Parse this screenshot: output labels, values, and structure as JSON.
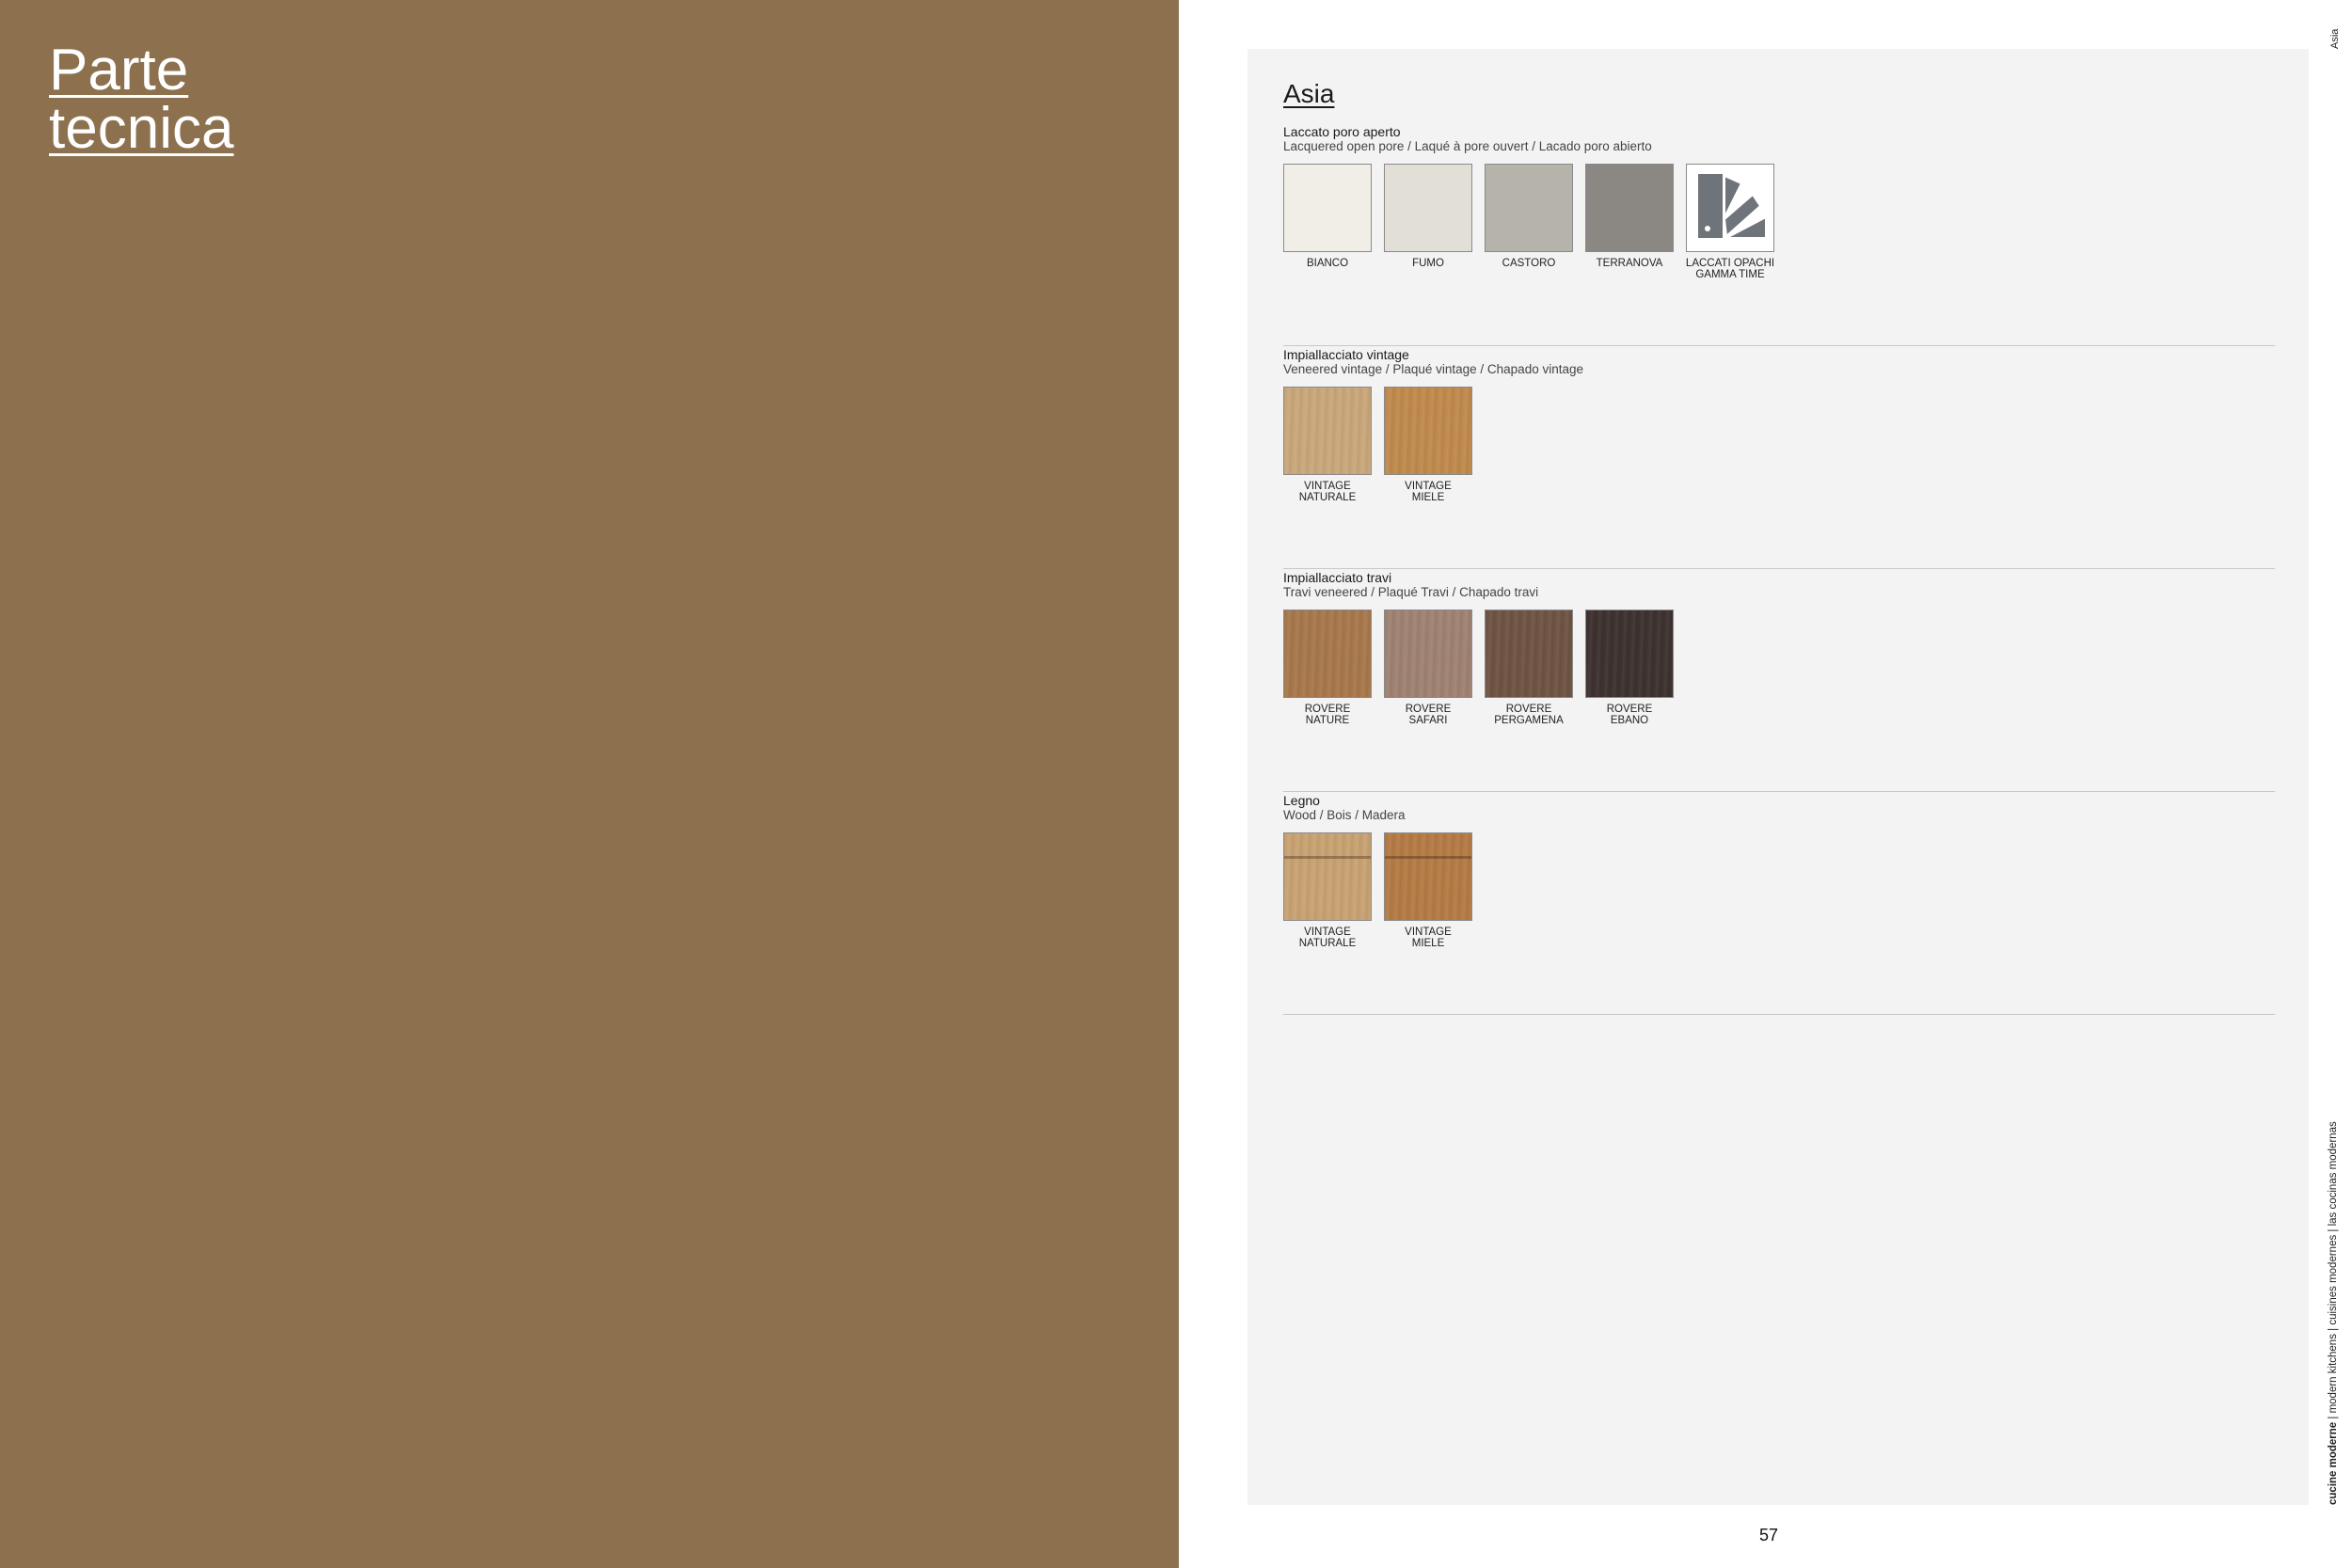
{
  "left": {
    "title_line1": "Parte",
    "title_line2": "tecnica"
  },
  "card": {
    "title": "Asia"
  },
  "sections": [
    {
      "title": "Laccato poro aperto",
      "subtitle": "Lacquered open pore / Laqué à pore ouvert / Lacado poro abierto",
      "swatches": [
        {
          "line1": "BIANCO",
          "line2": "",
          "color": "#f0eee6"
        },
        {
          "line1": "FUMO",
          "line2": "",
          "color": "#e2e0d6"
        },
        {
          "line1": "CASTORO",
          "line2": "",
          "color": "#b6b3aa"
        },
        {
          "line1": "TERRANOVA",
          "line2": "",
          "color": "#8b8884"
        },
        {
          "line1": "LACCATI OPACHI",
          "line2": "GAMMA TIME",
          "color": "#ffffff",
          "icon": "color-fan-icon"
        }
      ]
    },
    {
      "title": "Impiallacciato vintage",
      "subtitle": "Veneered vintage / Plaqué vintage / Chapado vintage",
      "swatches": [
        {
          "line1": "VINTAGE",
          "line2": "NATURALE",
          "color": "#c9a77a"
        },
        {
          "line1": "VINTAGE",
          "line2": "MIELE",
          "color": "#c08a4d"
        }
      ]
    },
    {
      "title": "Impiallacciato travi",
      "subtitle": "Travi veneered / Plaqué Travi / Chapado travi",
      "swatches": [
        {
          "line1": "ROVERE",
          "line2": "NATURE",
          "color": "#a8784c"
        },
        {
          "line1": "ROVERE",
          "line2": "SAFARI",
          "color": "#9f8272"
        },
        {
          "line1": "ROVERE",
          "line2": "PERGAMENA",
          "color": "#6f5443"
        },
        {
          "line1": "ROVERE",
          "line2": "EBANO",
          "color": "#3e3230"
        }
      ]
    },
    {
      "title": "Legno",
      "subtitle": "Wood / Bois / Madera",
      "swatches": [
        {
          "line1": "VINTAGE",
          "line2": "NATURALE",
          "color": "#c8a273"
        },
        {
          "line1": "VINTAGE",
          "line2": "MIELE",
          "color": "#b47b45"
        }
      ]
    }
  ],
  "page_number": "57",
  "side_top": "Asia",
  "side_bottom_bold": "cucine moderne",
  "side_bottom_rest": " | modern kitchens | cuisines modernes | las cocinas modernas"
}
